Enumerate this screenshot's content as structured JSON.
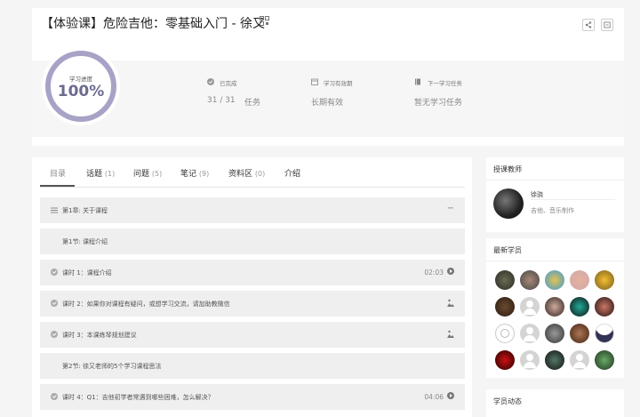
{
  "course": {
    "title": "【体验课】危险吉他：零基础入门 - 徐又",
    "progress_label": "学习进度",
    "progress_value": "100%",
    "progress_fraction": 1.0,
    "stats": [
      {
        "label": "已完成",
        "value_a": "31 / 31",
        "value_b": "任务",
        "icon": "check-circle-icon"
      },
      {
        "label": "学习有效期",
        "value": "长期有效",
        "icon": "calendar-icon"
      },
      {
        "label": "下一学习任务",
        "value": "暂无学习任务",
        "icon": "book-icon"
      }
    ]
  },
  "tabs": [
    {
      "label": "目录",
      "count": ""
    },
    {
      "label": "话题",
      "count": "(1)"
    },
    {
      "label": "问题",
      "count": "(5)"
    },
    {
      "label": "笔记",
      "count": "(9)"
    },
    {
      "label": "资料区",
      "count": "(0)"
    },
    {
      "label": "介绍",
      "count": ""
    }
  ],
  "catalog": {
    "chapter": "第1章: 关于课程",
    "collapse_symbol": "−",
    "section1": "第1节: 课程介绍",
    "lesson1": {
      "text": "课时 1：课程介绍",
      "duration": "02:03"
    },
    "lesson2": {
      "text": "课时 2：如果你对课程有疑问，或想学习交流，请加助教微信"
    },
    "lesson3": {
      "text": "课时 3：本课练琴规划建议"
    },
    "section2": "第2节: 徐又老师的5个学习课程思法",
    "lesson4": {
      "text": "课时 4：Q1：吉他初学者常遇到哪些困难，怎么解决？",
      "duration": "04:06"
    }
  },
  "sidebar": {
    "teacher_title": "授课教师",
    "teacher_name": "徐骁",
    "teacher_desc": "吉他、音乐制作",
    "students_title": "最新学员",
    "activity_title": "学员动态"
  },
  "colors": {
    "progress_ring": "#a7a3c6",
    "accent": "#6b6b8f"
  }
}
